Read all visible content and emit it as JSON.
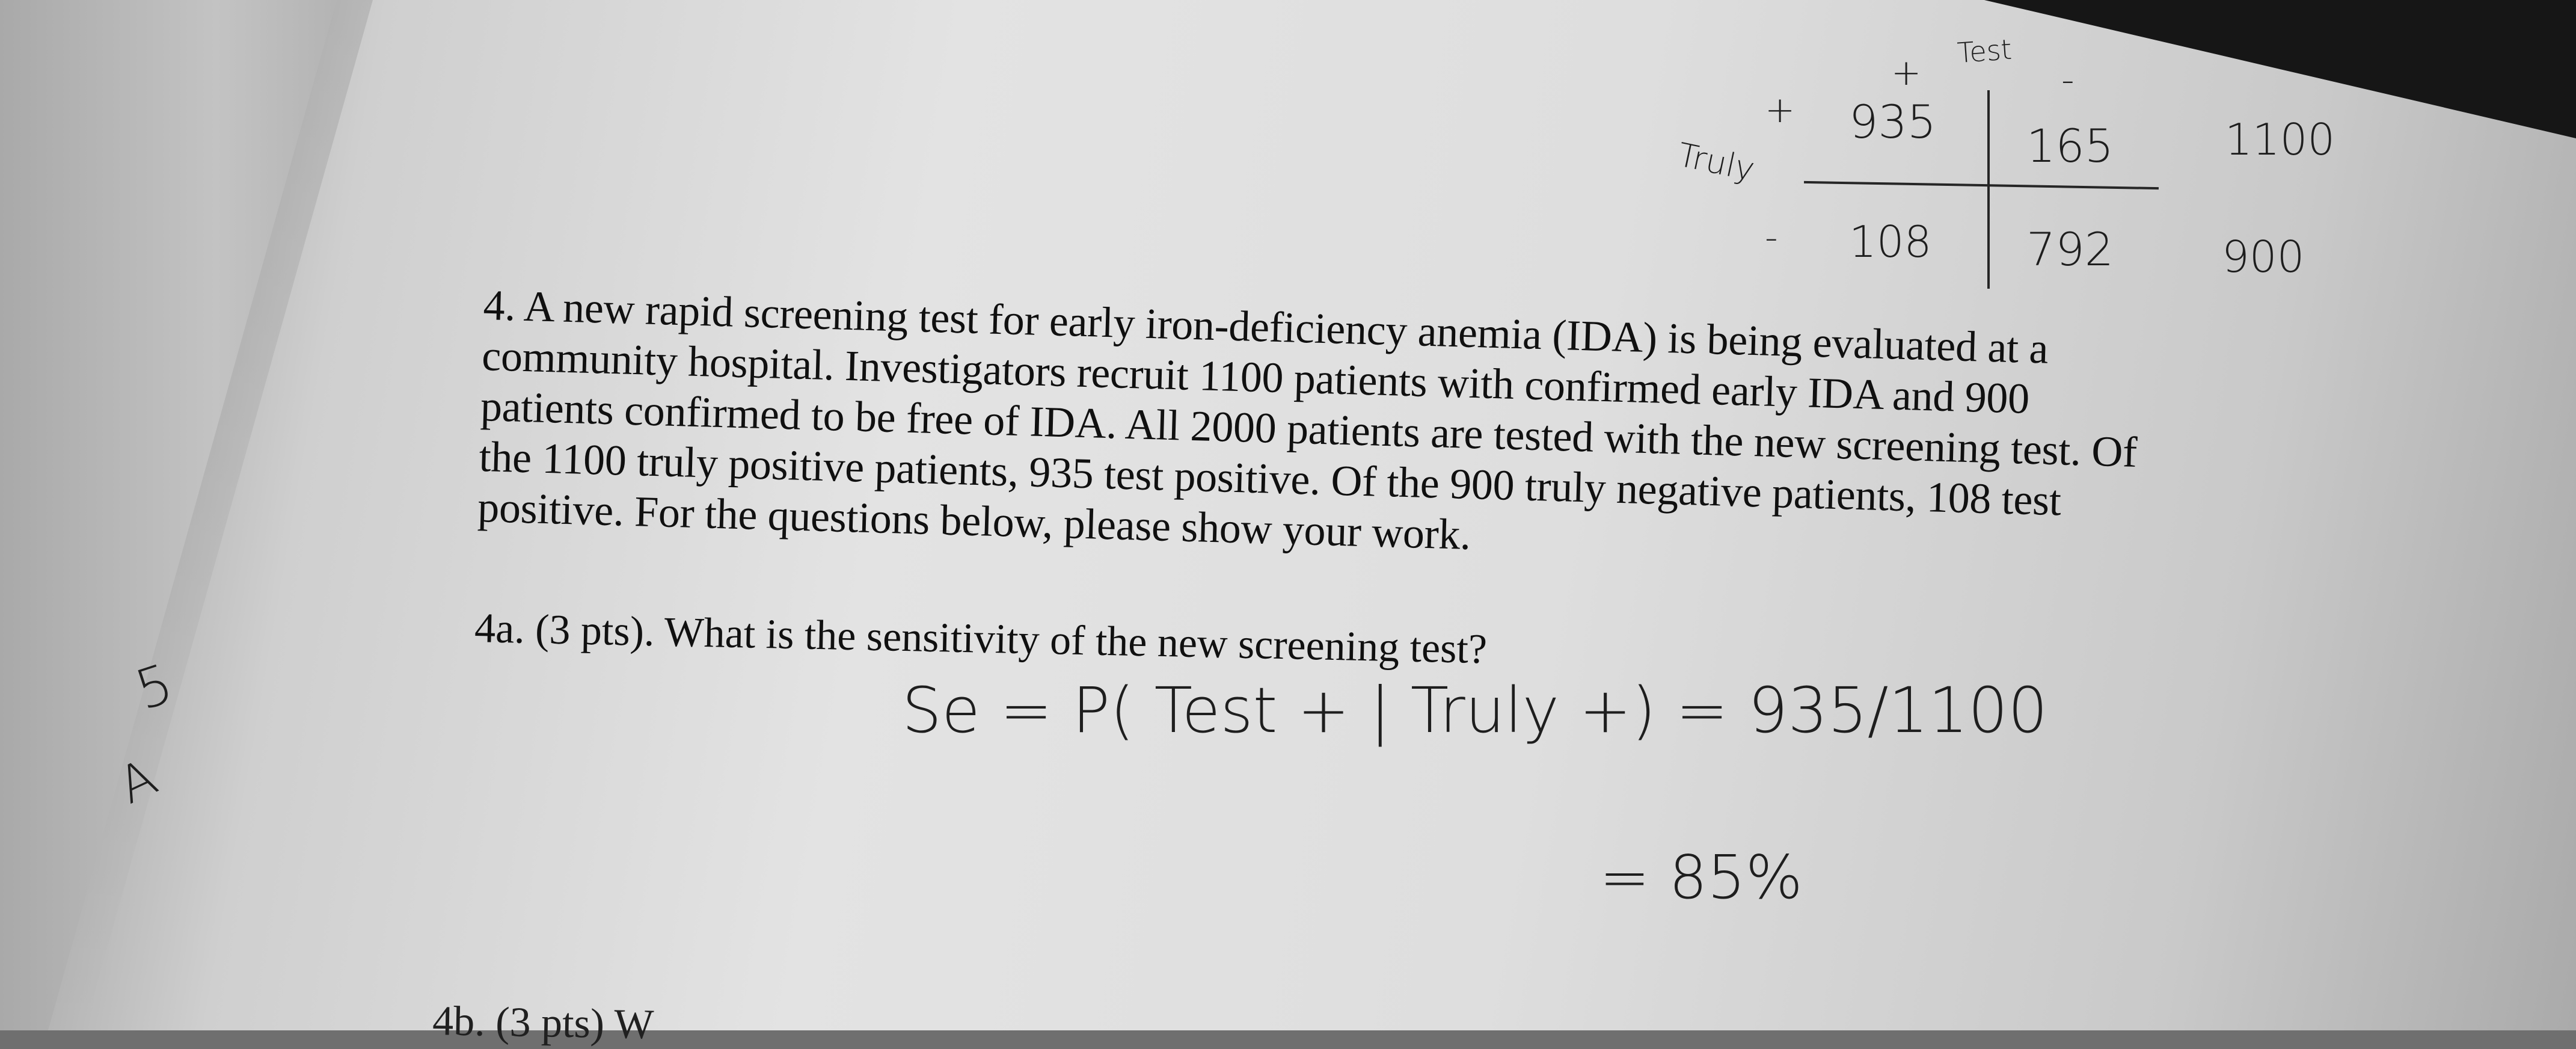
{
  "table": {
    "header_test": "Test",
    "col_plus": "+",
    "col_minus": "-",
    "row_label": "Truly",
    "row_plus": "+",
    "row_minus": "-",
    "cells": [
      [
        "935",
        "165",
        "1100"
      ],
      [
        "108",
        "792",
        "900"
      ]
    ]
  },
  "problem": {
    "lines": [
      "4. A new rapid screening test for early iron-deficiency anemia (IDA) is being evaluated at a",
      "community hospital. Investigators recruit 1100 patients with confirmed early IDA and 900",
      "patients confirmed to be free of IDA. All 2000 patients are tested with the new screening test. Of",
      "the 1100 truly positive patients, 935 test positive. Of the 900 truly negative patients, 108 test",
      "positive. For the questions below, please show your work."
    ]
  },
  "q4a": {
    "question": "4a. (3 pts). What is the sensitivity of the new screening test?",
    "answer_line1": "Se = P( Test + | Truly +) = 935/1100",
    "answer_line2": "= 85%"
  },
  "q4b": {
    "partial": "4b. (3 pts) W"
  },
  "margin_marks": [
    "5",
    "A"
  ]
}
